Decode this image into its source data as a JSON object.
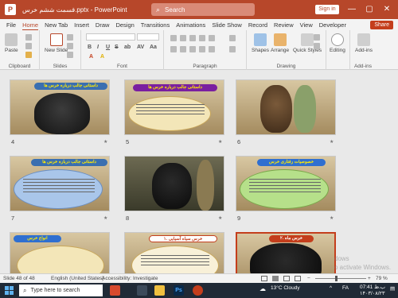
{
  "titlebar": {
    "app_icon": "P",
    "doc_title": "قسمت ششم خرس.pptx  -  PowerPoint",
    "search_placeholder": "Search",
    "signin_label": "Sign in",
    "minimize": "—",
    "maximize": "▢",
    "close": "✕"
  },
  "tabs": [
    "File",
    "Home",
    "New Tab",
    "Insert",
    "Draw",
    "Design",
    "Transitions",
    "Animations",
    "Slide Show",
    "Record",
    "Review",
    "View",
    "Developer"
  ],
  "share_label": "Share",
  "ribbon": {
    "groups": {
      "clipboard": "Clipboard",
      "slides": "Slides",
      "font": "Font",
      "paragraph": "Paragraph",
      "drawing": "Drawing",
      "addins": "Add-ins"
    },
    "buttons": {
      "paste": "Paste",
      "new_slide": "New Slide",
      "shapes": "Shapes",
      "arrange": "Arrange",
      "quick_styles": "Quick Styles",
      "editing": "Editing",
      "addins": "Add-ins"
    },
    "font_format": [
      "B",
      "I",
      "U",
      "S",
      "ab",
      "AV",
      "Aa",
      "A",
      "A"
    ]
  },
  "slides": [
    {
      "number": "4",
      "title": "داستانی جالب درباره خرس ها"
    },
    {
      "number": "5",
      "title": "داستانی جالب درباره خرس ها"
    },
    {
      "number": "6",
      "title": ""
    },
    {
      "number": "7",
      "title": "داستانی جالب درباره خرس ها"
    },
    {
      "number": "8",
      "title": ""
    },
    {
      "number": "9",
      "title": "خصوصیات رفتاری خرس"
    },
    {
      "number": "10",
      "title": "انواع خرس"
    },
    {
      "number": "11",
      "title": "۱. خرس سیاه آسیایی"
    },
    {
      "number": "12",
      "title": "۲. خرس ماه"
    }
  ],
  "status": {
    "slide_count": "Slide 48 of 48",
    "language": "English (United States)",
    "accessibility": "Accessibility: Investigate",
    "zoom": "79 %",
    "zoom_level": 0.79
  },
  "watermark": {
    "line1": "dows",
    "line2": "o activate Windows."
  },
  "taskbar": {
    "search_placeholder": "Type here to search",
    "weather": "13°C  Cloudy",
    "language": "FA",
    "time": "07:41 ب.ظ",
    "date": "۱۴۰۳/۰۸/۲۳"
  },
  "colors": {
    "accent": "#b7472a",
    "selected_border": "#c43e1c",
    "taskbar": "#202a36"
  }
}
